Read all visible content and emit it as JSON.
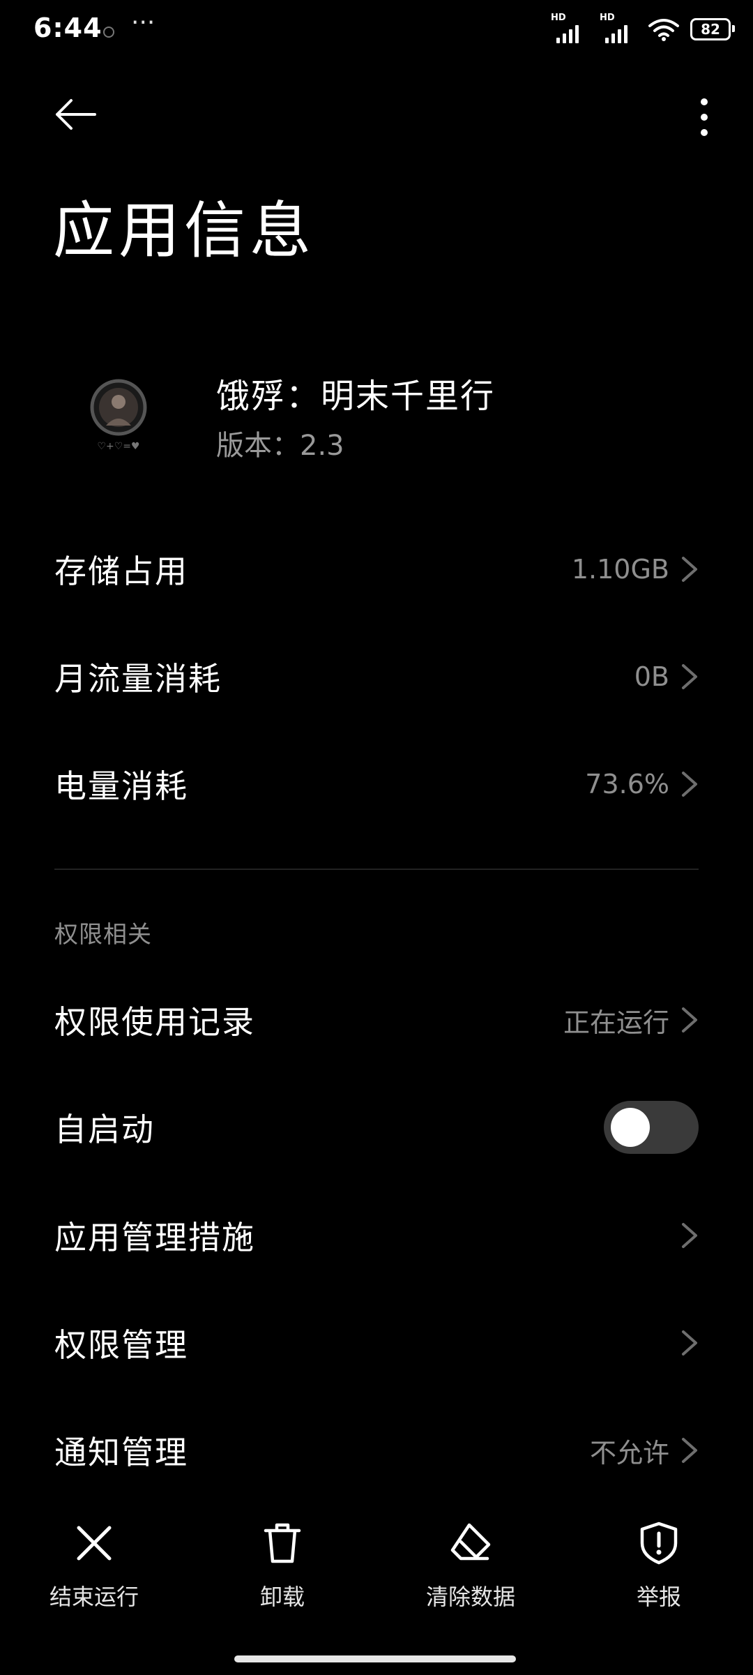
{
  "status_bar": {
    "time": "6:44",
    "dots": "···",
    "signal_label": "HD",
    "battery": "82"
  },
  "header": {
    "title": "应用信息"
  },
  "app": {
    "name": "饿殍：明末千里行",
    "version": "版本：2.3",
    "icon": "app-avatar-icon"
  },
  "rows": {
    "storage": {
      "label": "存储占用",
      "value": "1.10GB"
    },
    "traffic": {
      "label": "月流量消耗",
      "value": "0B"
    },
    "battery": {
      "label": "电量消耗",
      "value": "73.6%"
    }
  },
  "section_permissions": "权限相关",
  "perm_rows": {
    "usage": {
      "label": "权限使用记录",
      "value": "正在运行"
    },
    "autostart": {
      "label": "自启动",
      "enabled": false
    },
    "measures": {
      "label": "应用管理措施"
    },
    "permissions": {
      "label": "权限管理"
    },
    "notifications": {
      "label": "通知管理",
      "value": "不允许"
    }
  },
  "bottom_bar": {
    "force_stop": "结束运行",
    "uninstall": "卸载",
    "clear_data": "清除数据",
    "report": "举报"
  },
  "colors": {
    "background": "#000000",
    "text": "#ffffff",
    "secondary": "#8f8f8f",
    "toggle_off": "#3a3a3a"
  }
}
